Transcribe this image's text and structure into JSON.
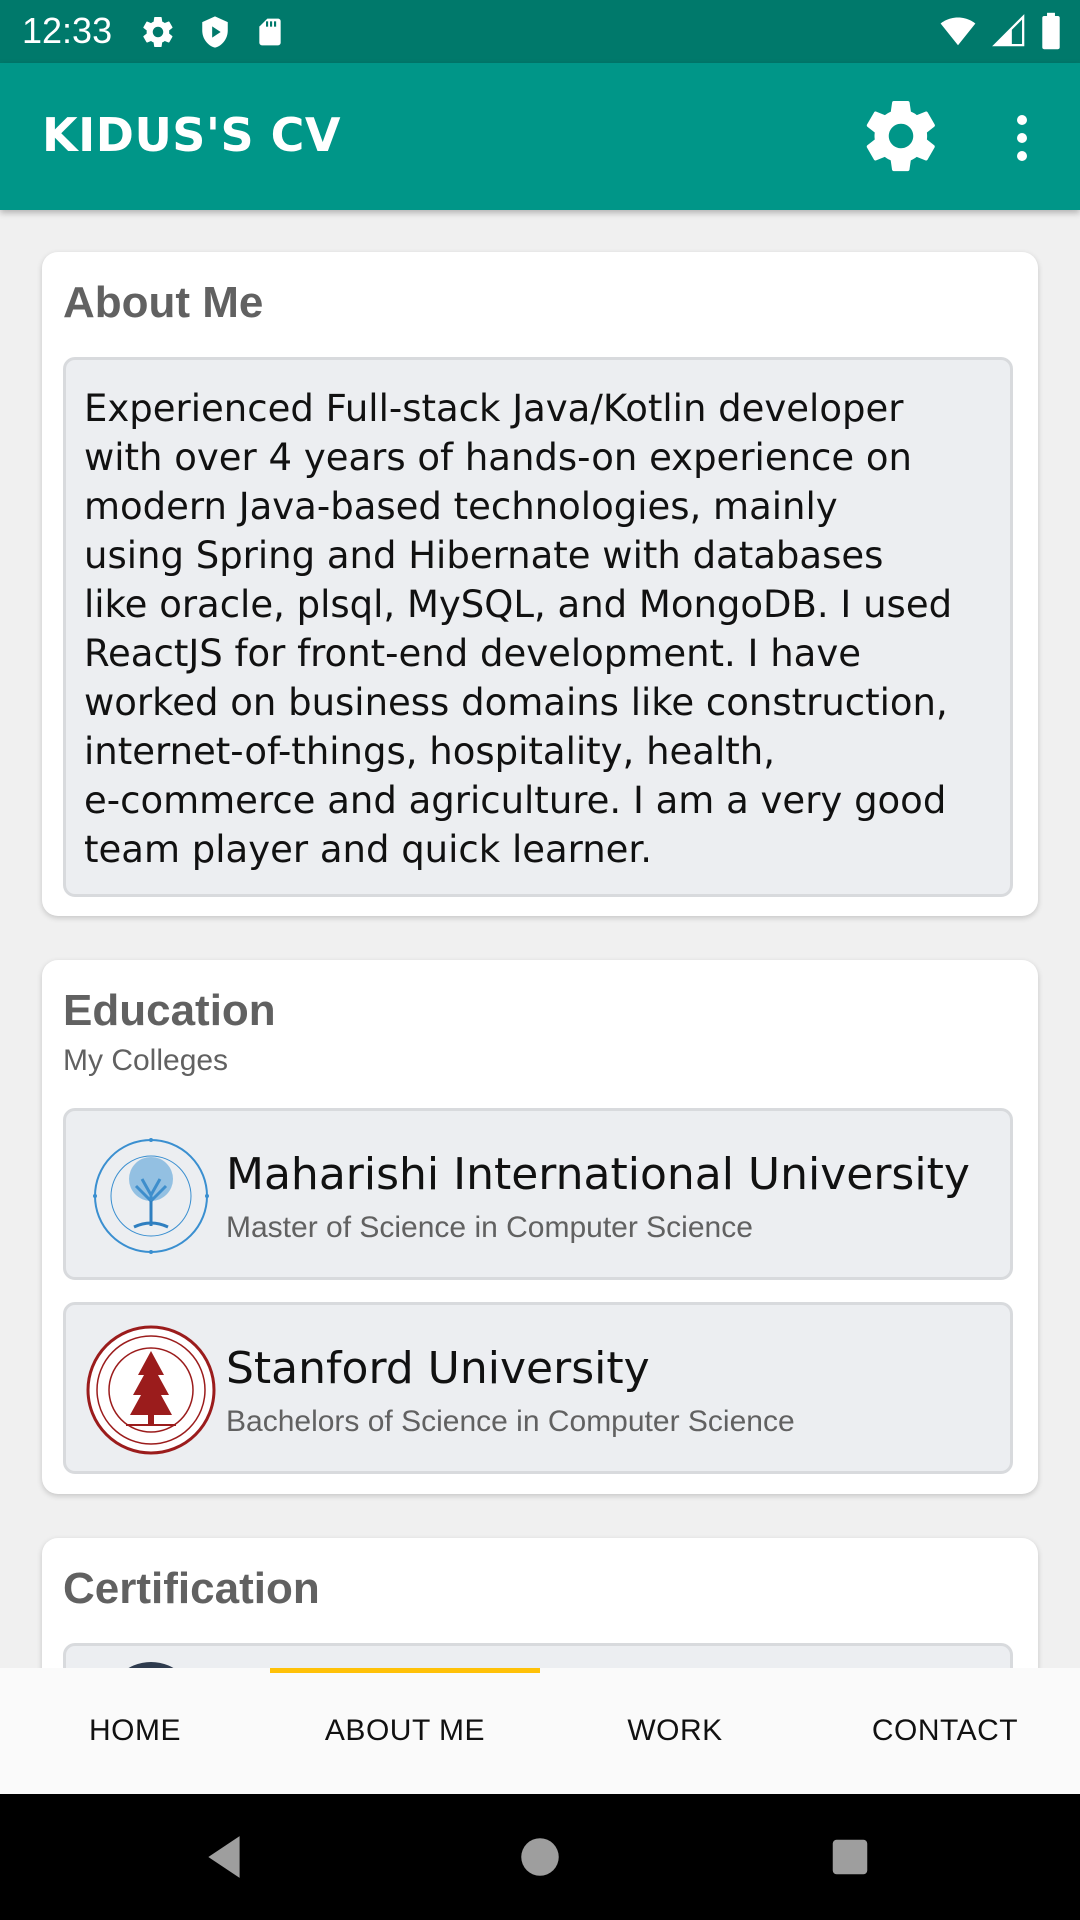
{
  "status_bar": {
    "time": "12:33",
    "left_icons": [
      "gear-icon",
      "shield-icon",
      "sd-card-icon"
    ],
    "right_icons": [
      "wifi-icon",
      "signal-icon",
      "battery-icon"
    ]
  },
  "app_bar": {
    "title": "KIDUS'S CV",
    "actions": [
      "gear-icon",
      "more-vert-icon"
    ]
  },
  "about": {
    "title": "About Me",
    "text": "Experienced Full-stack Java/Kotlin developer\nwith over 4 years of hands-on experience on\nmodern Java-based technologies, mainly\nusing Spring and Hibernate with databases\nlike oracle, plsql, MySQL, and MongoDB. I used\nReactJS for front-end development. I have\nworked on business domains like construction,\ninternet-of-things, hospitality, health,\ne-commerce and agriculture. I am a very good\nteam player and quick learner."
  },
  "education": {
    "title": "Education",
    "subtitle": "My Colleges",
    "colleges": [
      {
        "name": "Maharishi International University",
        "degree": "Master of Science in Computer Science",
        "logo": "miu-tree-seal-icon"
      },
      {
        "name": "Stanford University",
        "degree": "Bachelors of Science in Computer Science",
        "logo": "stanford-seal-icon"
      }
    ]
  },
  "certification": {
    "title": "Certification"
  },
  "tabs": [
    {
      "label": "HOME"
    },
    {
      "label": "ABOUT ME"
    },
    {
      "label": "WORK"
    },
    {
      "label": "CONTACT"
    }
  ],
  "selected_tab": "ABOUT ME",
  "nav_bar": [
    "back-icon",
    "home-icon",
    "recents-icon"
  ],
  "colors": {
    "status_bar": "#00796b",
    "app_bar": "#009688",
    "tab_indicator": "#ffc107",
    "card_title": "#616161",
    "inner_box": "#eceef1"
  }
}
